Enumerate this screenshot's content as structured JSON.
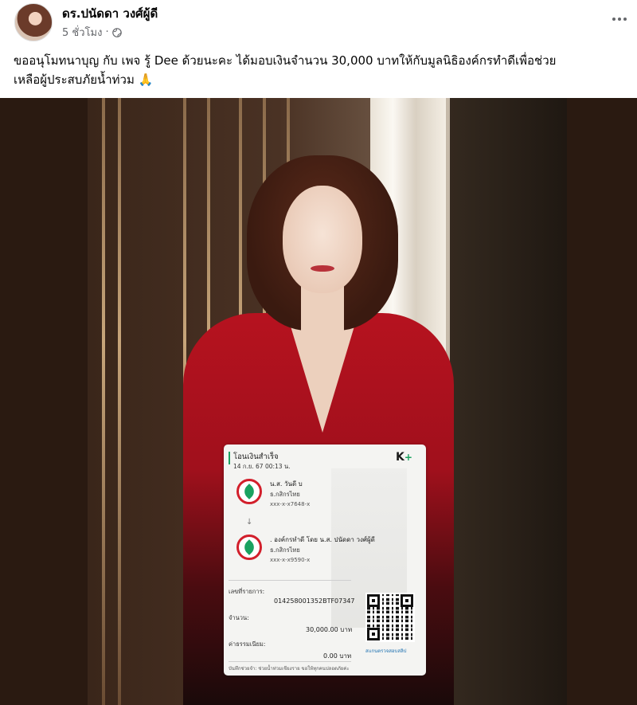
{
  "post": {
    "author": "ดร.ปนัดดา วงศ์ผู้ดี",
    "time": "5 ชั่วโมง",
    "privacy_icon": "globe-icon",
    "more_icon": "more-options-icon",
    "caption_line1": "ขออนุโมทนาบุญ กับ เพจ รู้ Dee ด้วยนะคะ ได้มอบเงินจำนวน 30,000 บาทให้กับมูลนิธิองค์กรทำดีเพื่อช่วย",
    "caption_line2": "เหลือผู้ประสบภัยน้ำท่วม",
    "caption_emoji": "🙏"
  },
  "slip": {
    "title": "โอนเงินสำเร็จ",
    "datetime": "14 ก.ย. 67  00:13 น.",
    "logo_text": "K",
    "logo_plus": "+",
    "from_name": "น.ส. วันดี บ",
    "from_bank": "ธ.กสิกรไทย",
    "from_account": "xxx-x-x7648-x",
    "arrow": "↓",
    "to_name": ". องค์กรทำดี โดย น.ส. ปนัดดา  วงศ์ผู้ดี",
    "to_bank": "ธ.กสิกรไทย",
    "to_account": "xxx-x-x9590-x",
    "ref_label": "เลขที่รายการ:",
    "ref_value": "014258001352BTF07347",
    "amount_label": "จำนวน:",
    "amount_value": "30,000.00 บาท",
    "fee_label": "ค่าธรรมเนียม:",
    "fee_value": "0.00 บาท",
    "qr_caption": "สแกนตรวจสอบสลิป",
    "note": "บันทึกช่วยจำ: ช่วยน้ำท่วมเชียงราย ขอให้ทุกคนปลอดภัยค่ะ"
  },
  "colors": {
    "kbank_green": "#1aa260",
    "kbank_red": "#d21f2b",
    "blazer_red": "#b6121f",
    "meta_gray": "#65676b"
  }
}
